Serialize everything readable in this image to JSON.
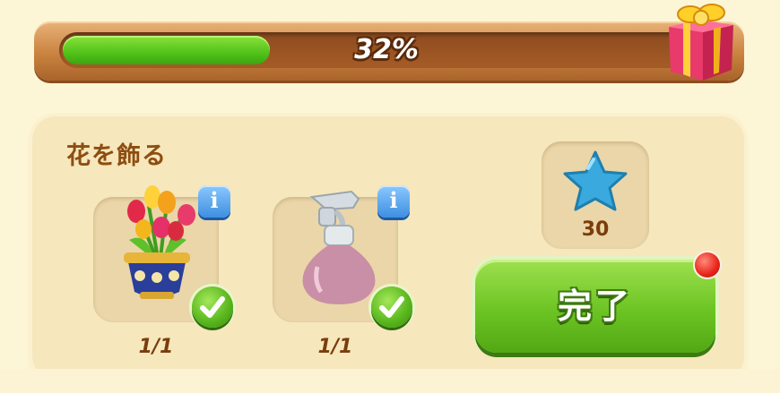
{
  "progress": {
    "percent_label": "32%",
    "fraction": 0.32
  },
  "task": {
    "title": "花を飾る",
    "items": [
      {
        "name": "tulip-flower-pot",
        "count": "1/1",
        "completed": true
      },
      {
        "name": "spray-bottle",
        "count": "1/1",
        "completed": true
      }
    ]
  },
  "reward": {
    "icon": "blue-star-icon",
    "amount": "30"
  },
  "complete_button": {
    "label": "完了"
  },
  "colors": {
    "progress_fill": "#51c21a",
    "button_green": "#6cc423",
    "text_brown": "#8e4d10",
    "info_blue": "#3e8fe0",
    "notification_red": "#e8231b"
  }
}
